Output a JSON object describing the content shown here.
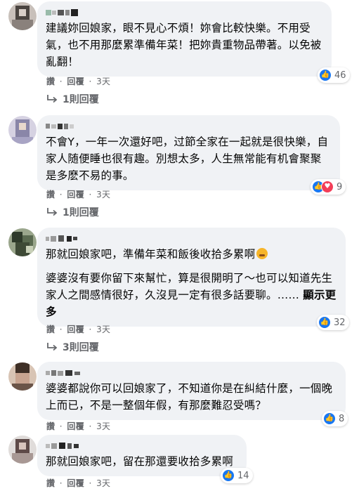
{
  "actions": {
    "like": "讚",
    "reply": "回覆",
    "separator": "·"
  },
  "comments": [
    {
      "paragraphs": [
        "建議妳回娘家，眼不見心不煩！妳會比較快樂。不用受氣，也不用那麼累準備年菜！把妳貴重物品帶著。以免被亂翻！"
      ],
      "time": "3天",
      "reactions": [
        "like"
      ],
      "reaction_count": "46",
      "replies": "1則回覆",
      "avatar_colors": [
        "#b8b0aa",
        "#4a4440"
      ]
    },
    {
      "paragraphs": [
        "不會Y，一年一次還好吧，过節全家在一起就是很快樂，自家人随便睡也很有趣。別想太多，人生無常能有机會聚聚是多麽不易的事。"
      ],
      "time": "3天",
      "reactions": [
        "like",
        "love"
      ],
      "reaction_count": "9",
      "replies": "1則回覆",
      "avatar_colors": [
        "#c9c4d6",
        "#8a86a8"
      ]
    },
    {
      "paragraphs": [
        "那就回娘家吧，準備年菜和飯後收拾多累啊",
        "婆婆沒有要你留下來幫忙，算是很開明了～也可以知道先生家人之間感情很好，久沒見一定有很多話要聊。……"
      ],
      "see_more": "顯示更多",
      "time": "3天",
      "reactions": [
        "like"
      ],
      "reaction_count": "32",
      "replies": "3則回覆",
      "avatar_colors": [
        "#7a8a6c",
        "#2e3a2a"
      ]
    },
    {
      "paragraphs": [
        "婆婆都說你可以回娘家了，不知道你是在糾結什麼，一個晚上而已，不是一整個年假，有那麼難忍受嗎？"
      ],
      "time": "3天",
      "reactions": [
        "like"
      ],
      "reaction_count": "8",
      "replies": "",
      "avatar_colors": [
        "#b89c8a",
        "#3e2f26"
      ]
    },
    {
      "paragraphs": [
        "那就回娘家吧，留在那還要收拾多累啊"
      ],
      "time": "3天",
      "reactions": [
        "like"
      ],
      "reaction_count": "14",
      "replies": "",
      "avatar_colors": [
        "#cfcac8",
        "#5e4a48"
      ]
    }
  ]
}
